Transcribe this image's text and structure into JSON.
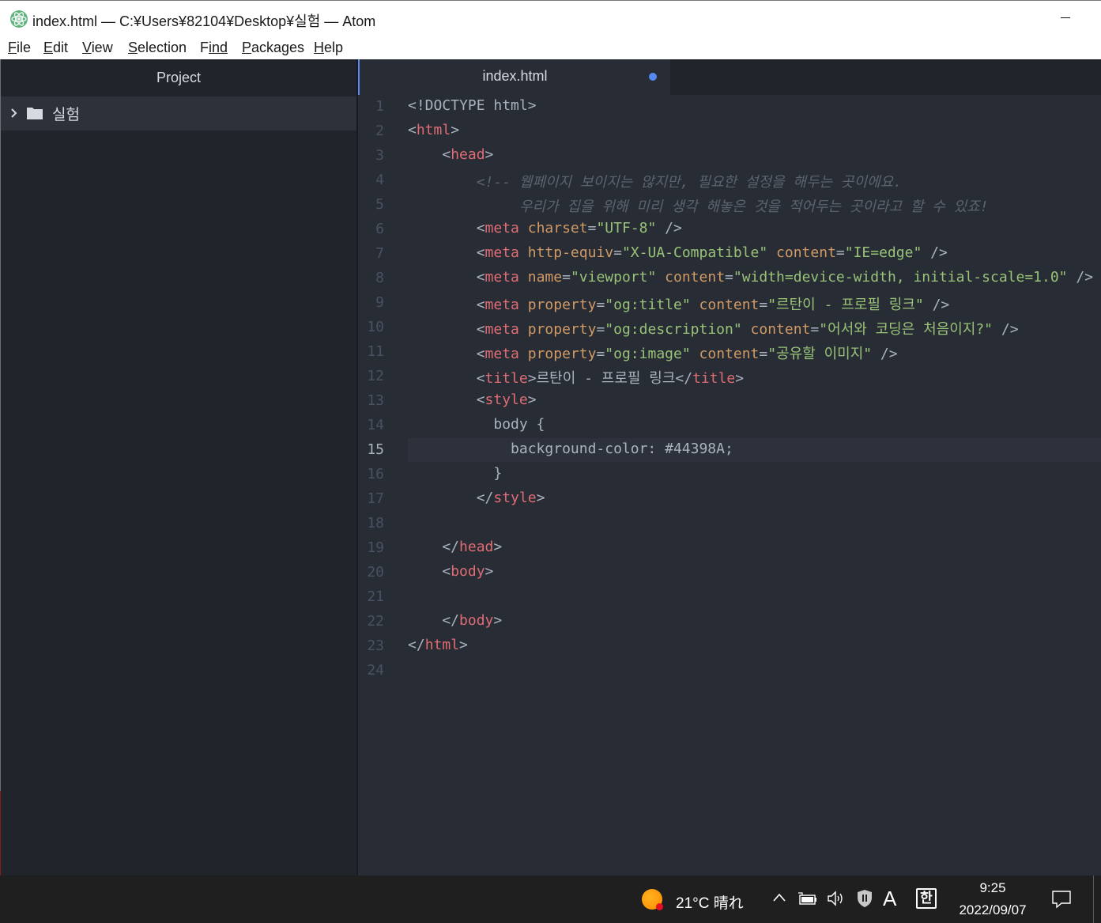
{
  "window": {
    "title": "index.html — C:¥Users¥82104¥Desktop¥실험 — Atom"
  },
  "menu": [
    {
      "key": "F",
      "rest": "ile"
    },
    {
      "key": "E",
      "rest": "dit"
    },
    {
      "key": "V",
      "rest": "iew"
    },
    {
      "key": "S",
      "rest": "election"
    },
    {
      "key": "F",
      "rest": "ind",
      "pre": ""
    },
    {
      "key": "P",
      "rest": "ackages"
    },
    {
      "key": "H",
      "rest": "elp"
    }
  ],
  "tree": {
    "header": "Project",
    "folder": "실험"
  },
  "tab": {
    "title": "index.html"
  },
  "editor": {
    "active_line": 15,
    "line_numbers": [
      "1",
      "2",
      "3",
      "4",
      "5",
      "6",
      "7",
      "8",
      "9",
      "10",
      "11",
      "12",
      "13",
      "14",
      "15",
      "16",
      "17",
      "18",
      "19",
      "20",
      "21",
      "22",
      "23",
      "24"
    ],
    "lines": [
      [
        [
          "pun",
          "<!DOCTYPE html>"
        ]
      ],
      [
        [
          "pun",
          "<"
        ],
        [
          "tag",
          "html"
        ],
        [
          "pun",
          ">"
        ]
      ],
      [
        [
          "pun",
          "    <"
        ],
        [
          "tag",
          "head"
        ],
        [
          "pun",
          ">"
        ]
      ],
      [
        [
          "cmt",
          "        <!-- 웹페이지 보이지는 않지만, 필요한 설정을 해두는 곳이에요."
        ]
      ],
      [
        [
          "cmt",
          "             우리가 집을 위해 미리 생각 해놓은 것을 적어두는 곳이라고 할 수 있죠!"
        ]
      ],
      [
        [
          "pun",
          "        <"
        ],
        [
          "tag",
          "meta"
        ],
        [
          "pun",
          " "
        ],
        [
          "attr",
          "charset"
        ],
        [
          "pun",
          "="
        ],
        [
          "str",
          "\"UTF-8\""
        ],
        [
          "pun",
          " />"
        ]
      ],
      [
        [
          "pun",
          "        <"
        ],
        [
          "tag",
          "meta"
        ],
        [
          "pun",
          " "
        ],
        [
          "attr",
          "http-equiv"
        ],
        [
          "pun",
          "="
        ],
        [
          "str",
          "\"X-UA-Compatible\""
        ],
        [
          "pun",
          " "
        ],
        [
          "attr",
          "content"
        ],
        [
          "pun",
          "="
        ],
        [
          "str",
          "\"IE=edge\""
        ],
        [
          "pun",
          " />"
        ]
      ],
      [
        [
          "pun",
          "        <"
        ],
        [
          "tag",
          "meta"
        ],
        [
          "pun",
          " "
        ],
        [
          "attr",
          "name"
        ],
        [
          "pun",
          "="
        ],
        [
          "str",
          "\"viewport\""
        ],
        [
          "pun",
          " "
        ],
        [
          "attr",
          "content"
        ],
        [
          "pun",
          "="
        ],
        [
          "str",
          "\"width=device-width, initial-scale=1.0\""
        ],
        [
          "pun",
          " />"
        ]
      ],
      [
        [
          "pun",
          "        <"
        ],
        [
          "tag",
          "meta"
        ],
        [
          "pun",
          " "
        ],
        [
          "attr",
          "property"
        ],
        [
          "pun",
          "="
        ],
        [
          "str",
          "\"og:title\""
        ],
        [
          "pun",
          " "
        ],
        [
          "attr",
          "content"
        ],
        [
          "pun",
          "="
        ],
        [
          "str",
          "\"르탄이 - 프로필 링크\""
        ],
        [
          "pun",
          " />"
        ]
      ],
      [
        [
          "pun",
          "        <"
        ],
        [
          "tag",
          "meta"
        ],
        [
          "pun",
          " "
        ],
        [
          "attr",
          "property"
        ],
        [
          "pun",
          "="
        ],
        [
          "str",
          "\"og:description\""
        ],
        [
          "pun",
          " "
        ],
        [
          "attr",
          "content"
        ],
        [
          "pun",
          "="
        ],
        [
          "str",
          "\"어서와 코딩은 처음이지?\""
        ],
        [
          "pun",
          " />"
        ]
      ],
      [
        [
          "pun",
          "        <"
        ],
        [
          "tag",
          "meta"
        ],
        [
          "pun",
          " "
        ],
        [
          "attr",
          "property"
        ],
        [
          "pun",
          "="
        ],
        [
          "str",
          "\"og:image\""
        ],
        [
          "pun",
          " "
        ],
        [
          "attr",
          "content"
        ],
        [
          "pun",
          "="
        ],
        [
          "str",
          "\"공유할 이미지\""
        ],
        [
          "pun",
          " />"
        ]
      ],
      [
        [
          "pun",
          "        <"
        ],
        [
          "tag",
          "title"
        ],
        [
          "pun",
          ">르탄이 - 프로필 링크</"
        ],
        [
          "tag",
          "title"
        ],
        [
          "pun",
          ">"
        ]
      ],
      [
        [
          "pun",
          "        <"
        ],
        [
          "tag",
          "style"
        ],
        [
          "pun",
          ">"
        ]
      ],
      [
        [
          "pun",
          "          body {"
        ]
      ],
      [
        [
          "pun",
          "            background-color: #44398A;"
        ]
      ],
      [
        [
          "pun",
          "          }"
        ]
      ],
      [
        [
          "pun",
          "        </"
        ],
        [
          "tag",
          "style"
        ],
        [
          "pun",
          ">"
        ]
      ],
      [],
      [
        [
          "pun",
          "    </"
        ],
        [
          "tag",
          "head"
        ],
        [
          "pun",
          ">"
        ]
      ],
      [
        [
          "pun",
          "    <"
        ],
        [
          "tag",
          "body"
        ],
        [
          "pun",
          ">"
        ]
      ],
      [],
      [
        [
          "pun",
          "    </"
        ],
        [
          "tag",
          "body"
        ],
        [
          "pun",
          ">"
        ]
      ],
      [
        [
          "pun",
          "</"
        ],
        [
          "tag",
          "html"
        ],
        [
          "pun",
          ">"
        ]
      ],
      []
    ]
  },
  "taskbar": {
    "weather": "21°C  晴れ",
    "ime_mode": "A",
    "ime_hangul": "한",
    "time": "9:25",
    "date": "2022/09/07"
  },
  "icons": {
    "app": "atom-icon",
    "folder": "folder-icon",
    "chevron": "chevron-right-icon",
    "weather": "sun-icon",
    "battery": "battery-icon",
    "volume": "volume-icon",
    "defender": "shield-icon",
    "notification": "notification-icon"
  },
  "colors": {
    "accent": "#568af2",
    "editor_bg": "#282c34",
    "panel_bg": "#21252b",
    "tag": "#e06c75",
    "attribute": "#d19a66",
    "string": "#98c379",
    "comment": "#5c6370"
  }
}
